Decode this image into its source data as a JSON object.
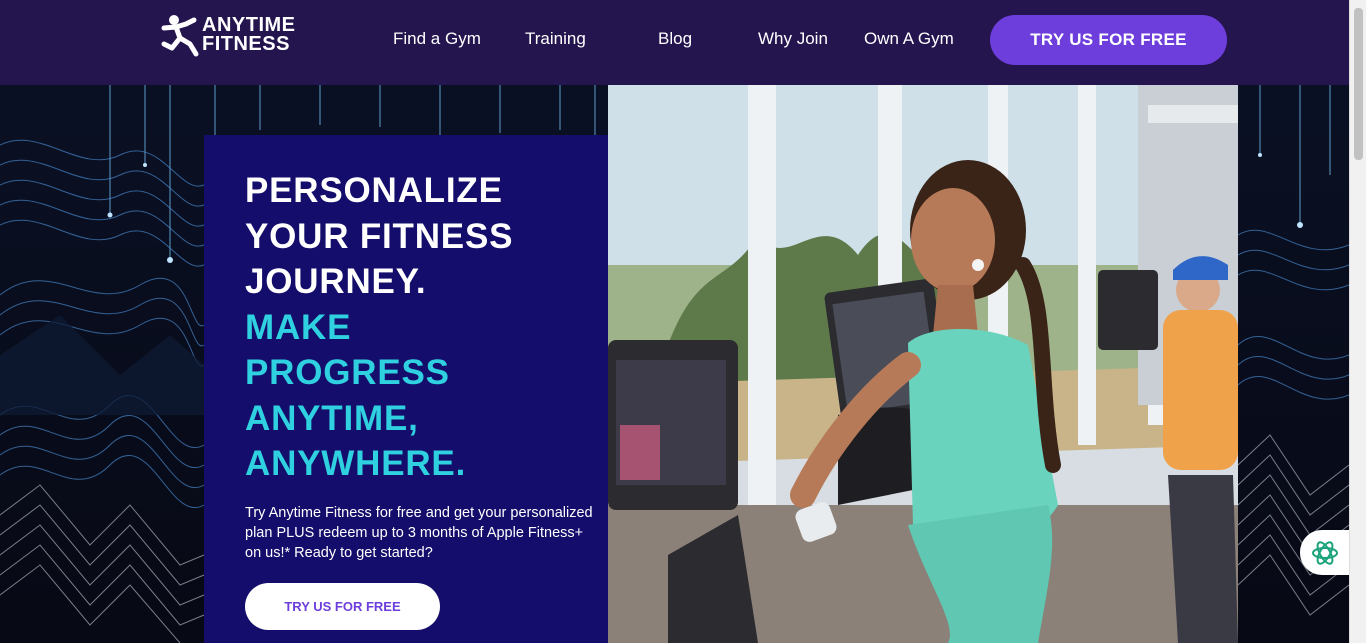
{
  "nav": {
    "logo_top": "ANYTIME",
    "logo_bottom": "FITNESS",
    "links": [
      "Find a Gym",
      "Training",
      "Blog",
      "Why Join",
      "Own A Gym"
    ],
    "cta": "TRY US FOR FREE"
  },
  "hero": {
    "headline_white": [
      "PERSONALIZE",
      "YOUR FITNESS",
      "JOURNEY."
    ],
    "headline_cyan": [
      "MAKE",
      "PROGRESS",
      "ANYTIME,",
      "ANYWHERE."
    ],
    "body": "Try Anytime Fitness for free and get your personalized plan PLUS redeem up to 3 months of Apple Fitness+ on us!* Ready to get started?",
    "cta": "TRY US FOR FREE"
  },
  "colors": {
    "nav_bg": "#25154f",
    "cta_purple": "#6d3edc",
    "panel_bg": "#140d6b",
    "headline_cyan": "#2fd0e0"
  },
  "icons": {
    "logo": "running-man-logo",
    "chat": "chat-assistant-icon"
  }
}
